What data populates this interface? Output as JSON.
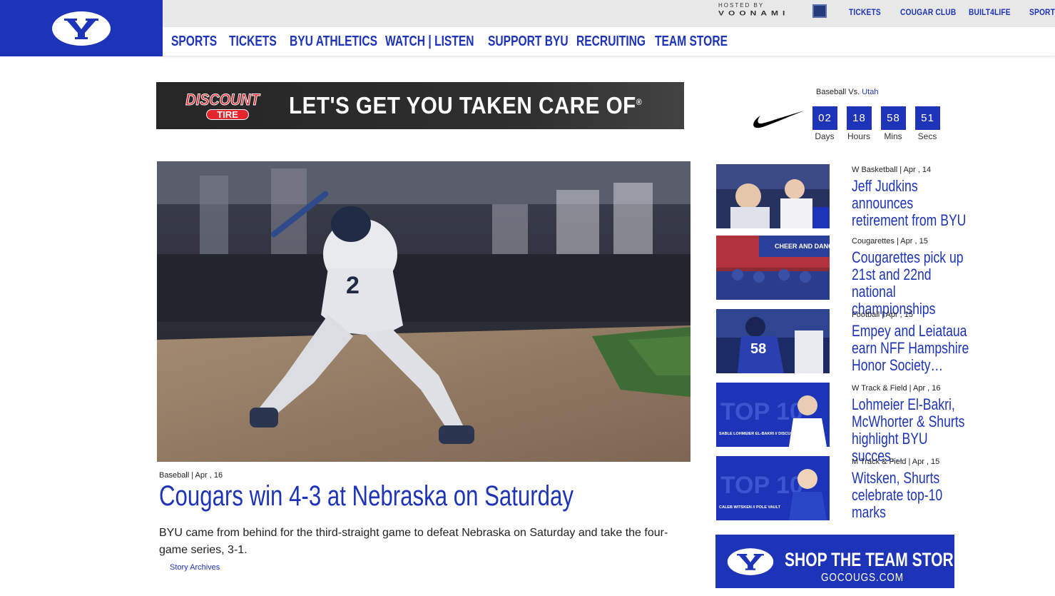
{
  "header": {
    "hosted_by": "HOSTED BY",
    "hosted_brand": "VOONAMI",
    "utility_links": [
      "TICKETS",
      "COUGAR CLUB",
      "BUILT4LIFE",
      "SPORTS"
    ],
    "nav": [
      "SPORTS",
      "TICKETS",
      "BYU ATHLETICS",
      "WATCH | LISTEN",
      "SUPPORT BYU",
      "RECRUITING",
      "TEAM STORE"
    ]
  },
  "ad": {
    "brand_top": "DISCOUNT",
    "brand_bottom": "TIRE",
    "tagline": "LET'S GET YOU TAKEN CARE OF",
    "mark": "®"
  },
  "countdown": {
    "event_prefix": "Baseball Vs.",
    "opponent": "Utah",
    "days": "02",
    "hours": "18",
    "mins": "58",
    "secs": "51",
    "labels": [
      "Days",
      "Hours",
      "Mins",
      "Secs"
    ]
  },
  "hero": {
    "meta": "Baseball | Apr , 16",
    "title": "Cougars win 4-3 at Nebraska on Saturday",
    "description": "BYU came from behind for the third-straight game to defeat Nebraska on Saturday and take the four-game series, 3-1.",
    "archives_link": "Story Archives"
  },
  "stories": [
    {
      "meta": "W Basketball | Apr , 14",
      "title": "Jeff Judkins announces retirement from BYU"
    },
    {
      "meta": "Cougarettes | Apr , 15",
      "title": "Cougarettes pick up 21st and 22nd national championships"
    },
    {
      "meta": "Football | Apr , 15",
      "title": "Empey and Leiataua earn NFF Hampshire Honor Society…"
    },
    {
      "meta": "W Track & Field | Apr , 16",
      "title": "Lohmeier El-Bakri, McWhorter & Shurts highlight BYU succes…"
    },
    {
      "meta": "M Track & Field | Apr , 15",
      "title": "Witsken, Shurts celebrate top-10 marks"
    }
  ],
  "thumb_text": {
    "cheer": "CHEER AND DANCE",
    "top10": "TOP 10",
    "sable_caption": "SABLE LOHMEIER EL-BAKRI // DISCUS",
    "caleb_caption": "CALEB WITSKEN // POLE VAULT",
    "jersey": "58",
    "hero_jersey": "2"
  },
  "shop": {
    "title": "SHOP THE TEAM STORE",
    "url": "GOCOUGS.COM"
  },
  "colors": {
    "byu_blue": "#1e34b8",
    "topbar_gray": "#e8e8e8",
    "text": "#222222"
  }
}
